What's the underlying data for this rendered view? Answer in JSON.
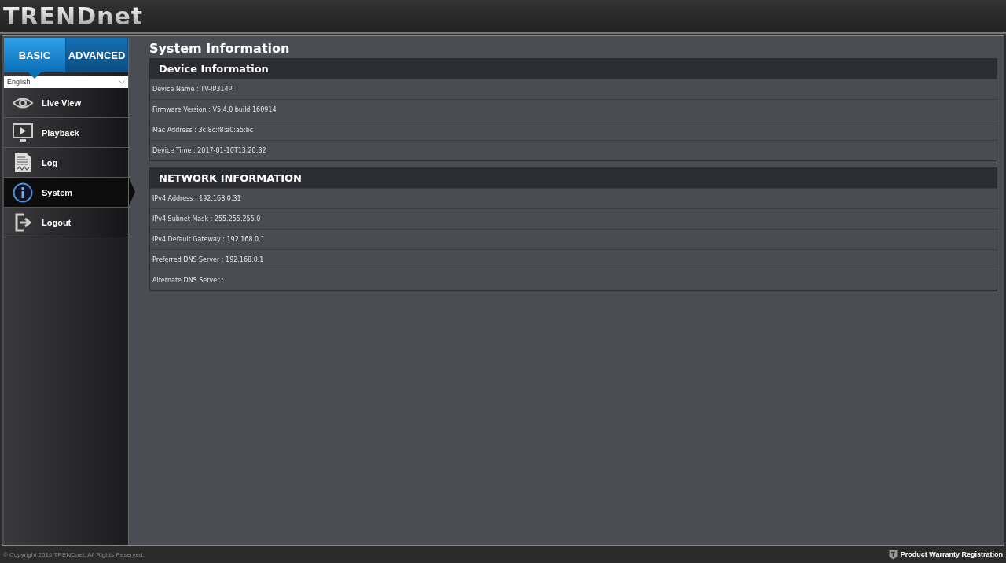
{
  "logo": "TRENDnet",
  "tabs": [
    {
      "label": "BASIC",
      "selected": true
    },
    {
      "label": "ADVANCED",
      "selected": false
    }
  ],
  "language": "English",
  "nav": [
    {
      "label": "Live View",
      "kind": "eye",
      "selected": false
    },
    {
      "label": "Playback",
      "kind": "monitor",
      "selected": false
    },
    {
      "label": "Log",
      "kind": "document",
      "selected": false
    },
    {
      "label": "System",
      "kind": "info",
      "selected": true
    },
    {
      "label": "Logout",
      "kind": "exit",
      "selected": false
    }
  ],
  "page_title": "System Information",
  "sections": [
    {
      "title": "Device Information",
      "rows": [
        "Device Name : TV-IP314PI",
        "Firmware Version : V5.4.0 build 160914",
        "Mac Address : 3c:8c:f8:a0:a5:bc",
        "Device Time : 2017-01-10T13:20:32"
      ]
    },
    {
      "title": "NETWORK INFORMATION",
      "rows": [
        "IPv4 Address : 192.168.0.31",
        "IPv4 Subnet Mask : 255.255.255.0",
        "IPv4 Default Gateway : 192.168.0.1",
        "Preferred DNS Server : 192.168.0.1",
        "Alternate DNS Server :"
      ]
    }
  ],
  "footer": {
    "copyright": "© Copyright 2016 TRENDnet. All Rights Reserved.",
    "warranty": "Product Warranty Registration"
  }
}
